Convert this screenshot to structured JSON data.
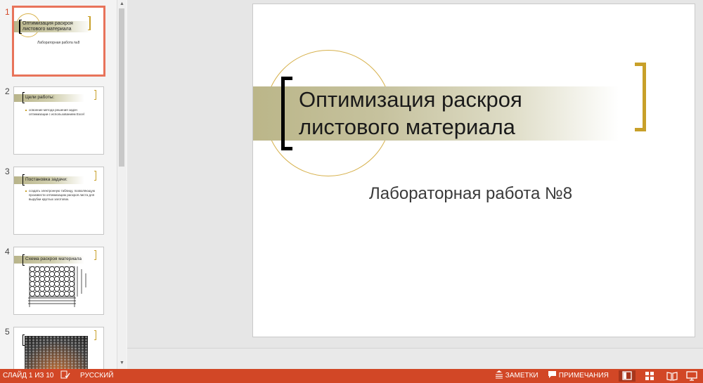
{
  "thumbnails": [
    {
      "number": "1",
      "title": "Оптимизация раскроя листового материала",
      "subtitle": "Лабораторная работа №8"
    },
    {
      "number": "2",
      "title": "Цели работы:",
      "body": "освоение метода решения задач оптимизации с использованием Excel"
    },
    {
      "number": "3",
      "title": "Постановка задачи:",
      "body": "создать электронную таблицу, позволяющую произвести оптимизацию раскроя листа для вырубки круглых заготовок."
    },
    {
      "number": "4",
      "title": "Схема раскроя материала"
    },
    {
      "number": "5"
    }
  ],
  "slide": {
    "title": "Оптимизация раскроя листового материала",
    "subtitle": "Лабораторная работа №8"
  },
  "statusbar": {
    "slide_indicator": "СЛАЙД 1 ИЗ 10",
    "language": "РУССКИЙ",
    "notes": "ЗАМЕТКИ",
    "comments": "ПРИМЕЧАНИЯ"
  },
  "colors": {
    "accent": "#d24726",
    "gold": "#c8a02a",
    "selection": "#e8735a"
  }
}
